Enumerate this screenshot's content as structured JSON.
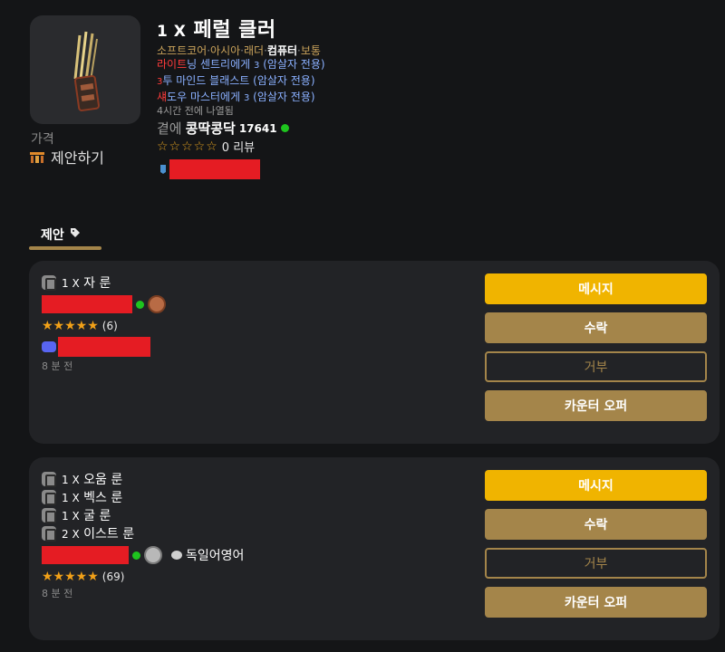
{
  "listing": {
    "quantity": "1 X",
    "item_name": "페럴 클러",
    "tags": [
      {
        "text": "소프트코어",
        "highlight": false
      },
      {
        "text": "아시아",
        "highlight": false
      },
      {
        "text": "래더",
        "highlight": false
      },
      {
        "text": "컴퓨터",
        "highlight": true
      },
      {
        "text": "보통",
        "highlight": false
      }
    ],
    "tag_separator": "·",
    "mods": [
      {
        "prefix": "라이트",
        "text": "닝 센트리에게 ",
        "num": "3",
        "suffix": " (암살자 전용)"
      },
      {
        "prefix": "3",
        "text": "투 마인드 블래스트 (암살자 전용)",
        "num": "",
        "suffix": ""
      },
      {
        "prefix": "섀",
        "text": "도우 마스터에게 ",
        "num": "3",
        "suffix": " (암살자 전용)"
      }
    ],
    "listed_num": "4",
    "listed_text": "시간 전에 나열됨",
    "seller_prefix": "곁에",
    "seller_name": "콩딱콩닥",
    "seller_score": "17641",
    "seller_stars": "☆☆☆☆☆",
    "seller_reviews_num": "0",
    "seller_reviews_label": "리뷰",
    "price_label": "가격",
    "offer_label": "제안하기",
    "colors": {
      "online": "#1ec41e",
      "accent_gold": "#a4854a",
      "message_yellow": "#f0b400",
      "redaction": "#e51c23",
      "discord": "#5865f2"
    }
  },
  "tabs": {
    "offers_label": "제안",
    "offers_icon": "tag-icon"
  },
  "offers": [
    {
      "items": [
        {
          "qty": "1 X",
          "name": "자 룬",
          "icon": "rune-icon"
        }
      ],
      "buyer_badge": "bronze-badge-icon",
      "language": "",
      "stars": "★★★★★",
      "rating_count": "(6)",
      "time_num": "8",
      "time_text": "분 전",
      "has_discord": true
    },
    {
      "items": [
        {
          "qty": "1 X",
          "name": "오움 룬",
          "icon": "rune-icon"
        },
        {
          "qty": "1 X",
          "name": "벡스 룬",
          "icon": "rune-icon"
        },
        {
          "qty": "1 X",
          "name": "굴 룬",
          "icon": "rune-icon"
        },
        {
          "qty": "2 X",
          "name": "이스트 룬",
          "icon": "rune-icon"
        }
      ],
      "buyer_badge": "silver-badge-icon",
      "language": "독일어영어",
      "stars": "★★★★★",
      "rating_count": "(69)",
      "time_num": "8",
      "time_text": "분 전",
      "has_discord": false
    }
  ],
  "buttons": {
    "message": "메시지",
    "accept": "수락",
    "decline": "거부",
    "counter": "카운터 오퍼"
  }
}
